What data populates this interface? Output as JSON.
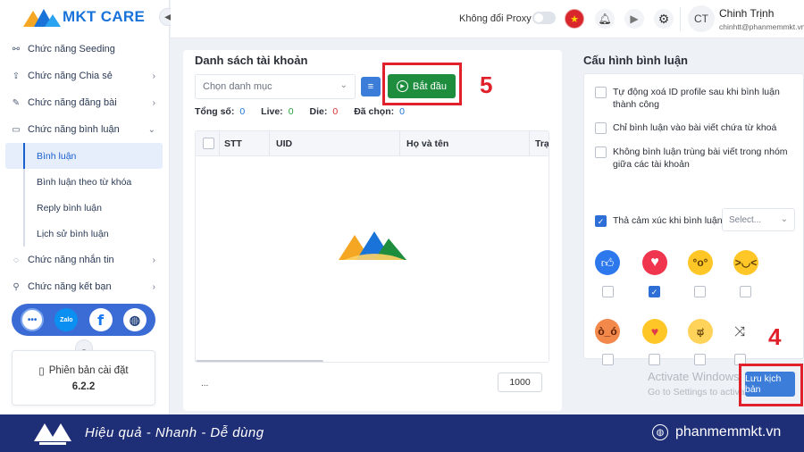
{
  "app": {
    "brand": "MKT CARE"
  },
  "sidebar": {
    "items": [
      {
        "label": "Chức năng Seeding",
        "icon": "share-nodes-icon"
      },
      {
        "label": "Chức năng Chia sẻ",
        "icon": "share-box-icon"
      },
      {
        "label": "Chức năng đăng bài",
        "icon": "edit-icon"
      },
      {
        "label": "Chức năng bình luận",
        "icon": "comment-icon"
      }
    ],
    "submenu": [
      {
        "label": "Bình luận",
        "active": true
      },
      {
        "label": "Bình luận theo từ khóa"
      },
      {
        "label": "Reply bình luận"
      },
      {
        "label": "Lịch sử bình luận"
      }
    ],
    "items2": [
      {
        "label": "Chức năng nhắn tin",
        "icon": "chat-icon"
      },
      {
        "label": "Chức năng kết bạn",
        "icon": "add-friend-icon"
      }
    ],
    "social": {
      "zalo": "Zalo",
      "fb": "f"
    },
    "version_label": "Phiên bản cài đặt",
    "version": "6.2.2"
  },
  "topbar": {
    "proxy_label": "Không đổi Proxy",
    "avatar": "CT",
    "user_name": "Chinh Trịnh",
    "user_email": "chinhtt@phanmemmkt.vn"
  },
  "accounts": {
    "title": "Danh sách tài khoản",
    "category_placeholder": "Chọn danh mục",
    "start_label": "Bắt đầu",
    "annotation": "5",
    "stats": {
      "total_label": "Tổng số:",
      "total": "0",
      "live_label": "Live:",
      "live": "0",
      "die_label": "Die:",
      "die": "0",
      "selected_label": "Đã chọn:",
      "selected": "0"
    },
    "columns": {
      "stt": "STT",
      "uid": "UID",
      "name": "Họ và tên",
      "status": "Trạng"
    },
    "footer_dots": "...",
    "page_size": "1000"
  },
  "config": {
    "title": "Cấu hình bình luận",
    "options": [
      {
        "label": "Tự động xoá ID profile sau khi bình luận thành công",
        "checked": false
      },
      {
        "label": "Chỉ bình luận vào bài viết chứa từ khoá",
        "checked": false
      },
      {
        "label": "Không bình luận trùng bài viết trong nhóm giữa các tài khoản",
        "checked": false
      },
      {
        "label": "Thả cảm xúc khi bình luận",
        "checked": true
      }
    ],
    "reaction_select_placeholder": "Select...",
    "reactions": [
      {
        "name": "like",
        "checked": false
      },
      {
        "name": "love",
        "checked": true
      },
      {
        "name": "wow",
        "checked": false
      },
      {
        "name": "haha",
        "checked": false
      },
      {
        "name": "angry",
        "checked": false
      },
      {
        "name": "care",
        "checked": false
      },
      {
        "name": "sad",
        "checked": false
      },
      {
        "name": "random",
        "checked": false
      }
    ],
    "save_label": "Lưu kịch bản",
    "annotation": "4",
    "watermark_title": "Activate Windows",
    "watermark_sub": "Go to Settings to activate Windows."
  },
  "banner": {
    "slogan": "Hiệu quả - Nhanh - Dễ dùng",
    "site": "phanmemmkt.vn"
  },
  "colors": {
    "brand": "#1a73d9",
    "start": "#1e8e3e",
    "highlight": "#e0202a",
    "banner": "#1f2f77"
  }
}
